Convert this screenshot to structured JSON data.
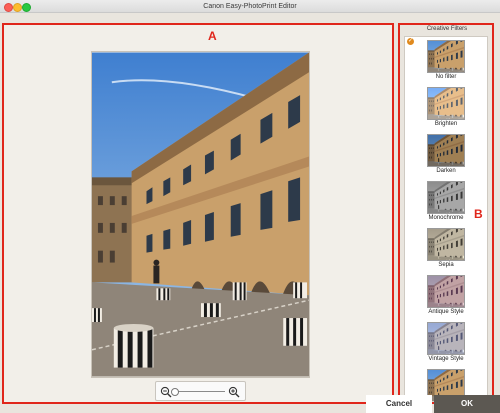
{
  "window": {
    "title": "Canon Easy-PhotoPrint Editor"
  },
  "annotations": {
    "main_area_label": "A",
    "filters_area_label": "B"
  },
  "preview": {
    "image": "photo of a classical palace courtyard with striped columns",
    "zoom_level": 0.0
  },
  "zoom": {
    "zoom_out_icon": "zoom-out-magnifier-icon",
    "zoom_in_icon": "zoom-in-magnifier-icon"
  },
  "filters": {
    "header": "Creative Filters",
    "selected": "No filter",
    "items": [
      {
        "label": "No filter",
        "tint": "none"
      },
      {
        "label": "Brighten",
        "tint": "bright"
      },
      {
        "label": "Darken",
        "tint": "dark"
      },
      {
        "label": "Monochrome",
        "tint": "mono"
      },
      {
        "label": "Sepia",
        "tint": "sepia"
      },
      {
        "label": "Antique Style",
        "tint": "antique"
      },
      {
        "label": "Vintage Style",
        "tint": "vintage"
      },
      {
        "label": "",
        "tint": "none"
      }
    ]
  },
  "buttons": {
    "cancel": "Cancel",
    "ok": "OK"
  },
  "colors": {
    "annotation_red": "#e0261b",
    "ok_button": "#5c5852",
    "selected_badge": "#e08a1e"
  }
}
